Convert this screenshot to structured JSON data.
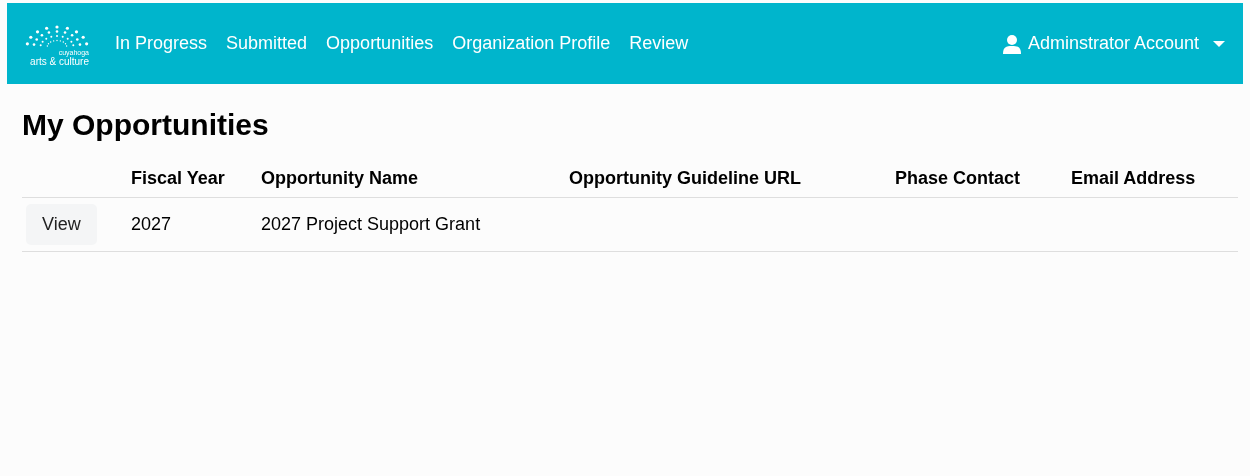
{
  "navbar": {
    "logo": {
      "small_text": "cuyahoga",
      "text": "arts & culture"
    },
    "links": [
      {
        "label": "In Progress"
      },
      {
        "label": "Submitted"
      },
      {
        "label": "Opportunities"
      },
      {
        "label": "Organization Profile"
      },
      {
        "label": "Review"
      }
    ],
    "account": {
      "label": "Adminstrator Account"
    }
  },
  "page": {
    "title": "My Opportunities"
  },
  "table": {
    "columns": [
      "",
      "Fiscal Year",
      "Opportunity Name",
      "Opportunity Guideline URL",
      "Phase Contact",
      "Email Address"
    ],
    "rows": [
      {
        "cells": [
          "View",
          "2027",
          "2027 Project Support Grant",
          "",
          "",
          ""
        ]
      }
    ]
  }
}
